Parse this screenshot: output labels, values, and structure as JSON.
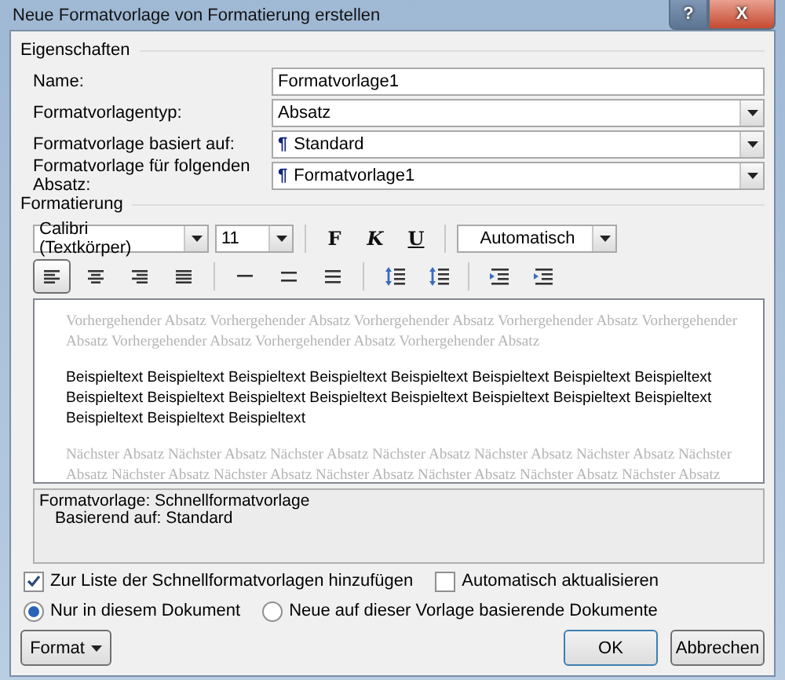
{
  "window": {
    "title": "Neue Formatvorlage von Formatierung erstellen",
    "help": "?",
    "close": "X"
  },
  "properties": {
    "heading": "Eigenschaften",
    "rows": [
      {
        "kind": "text",
        "label": "Name:",
        "value": "Formatvorlage1"
      },
      {
        "kind": "select",
        "label": "Formatvorlagentyp:",
        "value": "Absatz"
      },
      {
        "kind": "select",
        "label": "Formatvorlage basiert auf:",
        "value": "Standard",
        "marker": "¶"
      },
      {
        "kind": "select",
        "label": "Formatvorlage für folgenden Absatz:",
        "value": "Formatvorlage1",
        "marker": "¶"
      }
    ]
  },
  "formatting": {
    "heading": "Formatierung",
    "font": "Calibri (Textkörper)",
    "size": "11",
    "bold": "F",
    "italic": "K",
    "underline": "U",
    "font_color": "Automatisch",
    "alignment": [
      {
        "kind": "left",
        "selected": true
      },
      {
        "kind": "center",
        "selected": false
      },
      {
        "kind": "right",
        "selected": false
      },
      {
        "kind": "justify",
        "selected": false
      }
    ]
  },
  "preview": {
    "previous": [
      "Vorhergehender Absatz Vorhergehender Absatz Vorhergehender Absatz Vorhergehender Absatz Vorhergehender",
      "Absatz Vorhergehender Absatz Vorhergehender Absatz Vorhergehender Absatz"
    ],
    "sample": [
      "Beispieltext Beispieltext Beispieltext Beispieltext Beispieltext Beispieltext Beispieltext Beispieltext",
      "Beispieltext Beispieltext Beispieltext Beispieltext Beispieltext Beispieltext Beispieltext Beispieltext",
      "Beispieltext Beispieltext Beispieltext"
    ],
    "next": [
      "Nächster Absatz Nächster Absatz Nächster Absatz Nächster Absatz Nächster Absatz Nächster Absatz Nächster",
      "Absatz Nächster Absatz Nächster Absatz Nächster Absatz Nächster Absatz Nächster Absatz Nächster Absatz"
    ]
  },
  "description": [
    "Formatvorlage: Schnellformatvorlage",
    "Basierend auf: Standard"
  ],
  "checkboxes": [
    {
      "label": "Zur Liste der Schnellformatvorlagen hinzufügen",
      "checked": true
    },
    {
      "label": "Automatisch aktualisieren",
      "checked": false
    }
  ],
  "radios": [
    {
      "label": "Nur in diesem Dokument",
      "selected": true
    },
    {
      "label": "Neue auf dieser Vorlage basierende Dokumente",
      "selected": false
    }
  ],
  "buttons": {
    "format": "Format",
    "ok": "OK",
    "cancel": "Abbrechen"
  }
}
